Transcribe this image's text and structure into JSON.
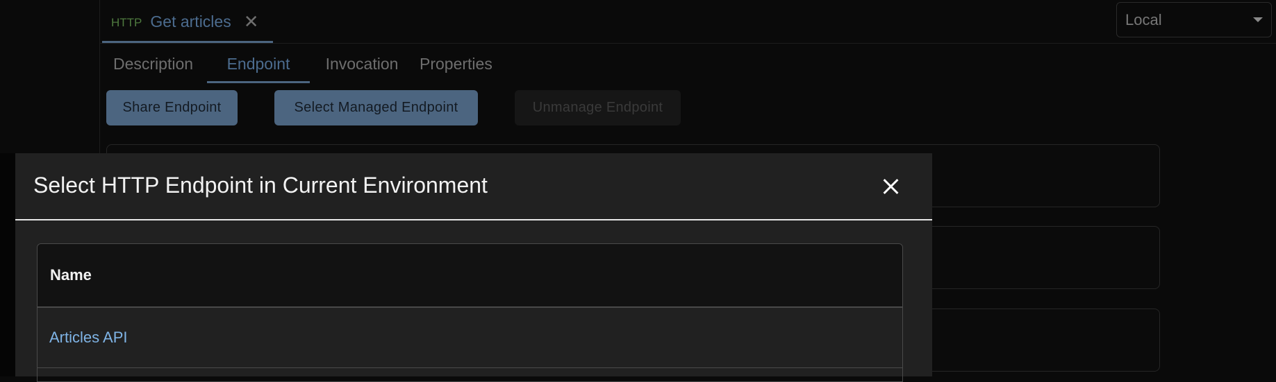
{
  "document_tab": {
    "method": "HTTP",
    "title": "Get articles",
    "close_icon": "close-icon"
  },
  "environment": {
    "selected": "Local",
    "icon": "chevron-down-icon"
  },
  "subtabs": [
    {
      "label": "Description",
      "active": false
    },
    {
      "label": "Endpoint",
      "active": true
    },
    {
      "label": "Invocation",
      "active": false
    },
    {
      "label": "Properties",
      "active": false
    }
  ],
  "actions": {
    "share": "Share Endpoint",
    "select_managed": "Select Managed Endpoint",
    "unmanage": "Unmanage Endpoint",
    "unmanage_disabled": true
  },
  "dialog": {
    "title": "Select HTTP Endpoint in Current Environment",
    "close_icon": "close-icon",
    "table": {
      "columns": [
        "Name"
      ],
      "rows": [
        {
          "name": "Articles API"
        }
      ]
    }
  },
  "colors": {
    "accent": "#4c6580",
    "method_green": "#4f7a3f",
    "link_blue": "#7fb4e6",
    "background": "#0a0a0a",
    "dialog_bg": "#212121"
  }
}
